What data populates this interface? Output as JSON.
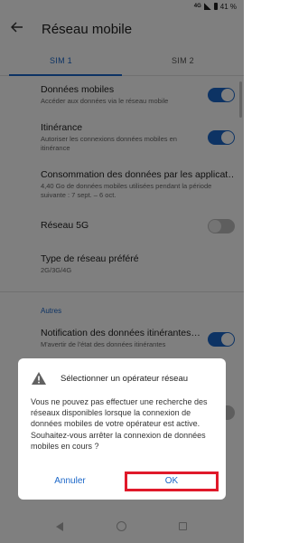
{
  "status_bar": {
    "network": "4G",
    "battery": "41 %"
  },
  "header": {
    "title": "Réseau mobile"
  },
  "tabs": [
    {
      "label": "SIM 1"
    },
    {
      "label": "SIM 2"
    }
  ],
  "settings": [
    {
      "title": "Données mobiles",
      "subtitle": "Accéder aux données via le réseau mobile",
      "toggle": "on"
    },
    {
      "title": "Itinérance",
      "subtitle": "Autoriser les connexions données mobiles en itinérance",
      "toggle": "on"
    },
    {
      "title": "Consommation des données par les applicat…",
      "subtitle": "4,40 Go de données mobiles utilisées pendant la période suivante : 7 sept. – 6 oct."
    },
    {
      "title": "Réseau 5G",
      "toggle": "off"
    },
    {
      "title": "Type de réseau préféré",
      "subtitle": "2G/3G/4G"
    }
  ],
  "section": {
    "label": "Autres"
  },
  "more_settings": [
    {
      "title": "Notification des données itinérantes…",
      "subtitle": "M'avertir de l'état des données itinérantes",
      "toggle": "on"
    }
  ],
  "dialog": {
    "icon": "warning-icon",
    "title": "Sélectionner un opérateur réseau",
    "message": "Vous ne pouvez pas effectuer une recherche des réseaux disponibles lorsque la connexion de données mobiles de votre opérateur est active. Souhaitez-vous arrêter la connexion de données mobiles en cours ?",
    "cancel_label": "Annuler",
    "ok_label": "OK"
  },
  "colors": {
    "accent": "#1a66c8",
    "highlight": "#e0192a"
  }
}
